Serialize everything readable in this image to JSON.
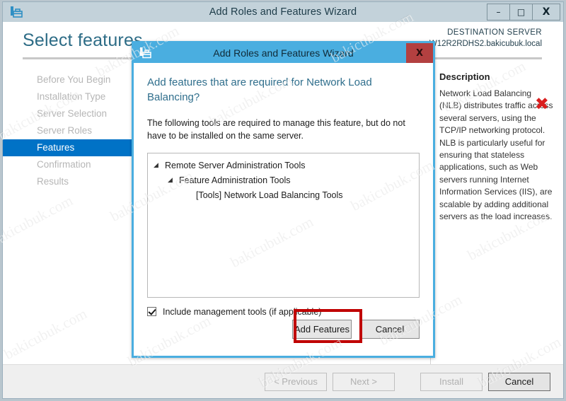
{
  "main_window": {
    "title": "Add Roles and Features Wizard",
    "icon": "wizard-toolbox-icon",
    "controls": {
      "minimize": "–",
      "maximize": "□",
      "close": "X"
    },
    "page_title": "Select features",
    "destination": {
      "label": "DESTINATION SERVER",
      "server": "W12R2RDHS2.bakicubuk.local"
    },
    "nav_items": [
      {
        "label": "Before You Begin",
        "active": false
      },
      {
        "label": "Installation Type",
        "active": false
      },
      {
        "label": "Server Selection",
        "active": false
      },
      {
        "label": "Server Roles",
        "active": false
      },
      {
        "label": "Features",
        "active": true
      },
      {
        "label": "Confirmation",
        "active": false
      },
      {
        "label": "Results",
        "active": false
      }
    ],
    "description": {
      "heading": "Description",
      "body": "Network Load Balancing (NLB) distributes traffic across several servers, using the TCP/IP networking protocol. NLB is particularly useful for ensuring that stateless applications, such as Web servers running Internet Information Services (IIS), are scalable by adding additional servers as the load increases."
    },
    "footer_buttons": [
      {
        "label": "< Previous",
        "enabled": false
      },
      {
        "label": "Next >",
        "enabled": false
      },
      {
        "label": "Install",
        "enabled": false
      },
      {
        "label": "Cancel",
        "enabled": true
      }
    ]
  },
  "dialog": {
    "title": "Add Roles and Features Wizard",
    "icon": "wizard-toolbox-icon",
    "close_label": "X",
    "heading": "Add features that are required for Network Load Balancing?",
    "subtext": "The following tools are required to manage this feature, but do not have to be installed on the same server.",
    "tree": [
      {
        "label": "Remote Server Administration Tools",
        "level": 1,
        "expander": "◢"
      },
      {
        "label": "Feature Administration Tools",
        "level": 2,
        "expander": "◢"
      },
      {
        "label": "[Tools] Network Load Balancing Tools",
        "level": 3,
        "expander": ""
      }
    ],
    "checkbox": {
      "label": "Include management tools (if applicable)",
      "checked": true
    },
    "buttons": [
      {
        "label": "Add Features",
        "highlighted": true
      },
      {
        "label": "Cancel",
        "highlighted": false
      }
    ]
  },
  "annotations": {
    "red_x_mark": "✖",
    "highlight_color": "#c00000"
  },
  "watermark": {
    "text": "bakicubuk.com"
  }
}
